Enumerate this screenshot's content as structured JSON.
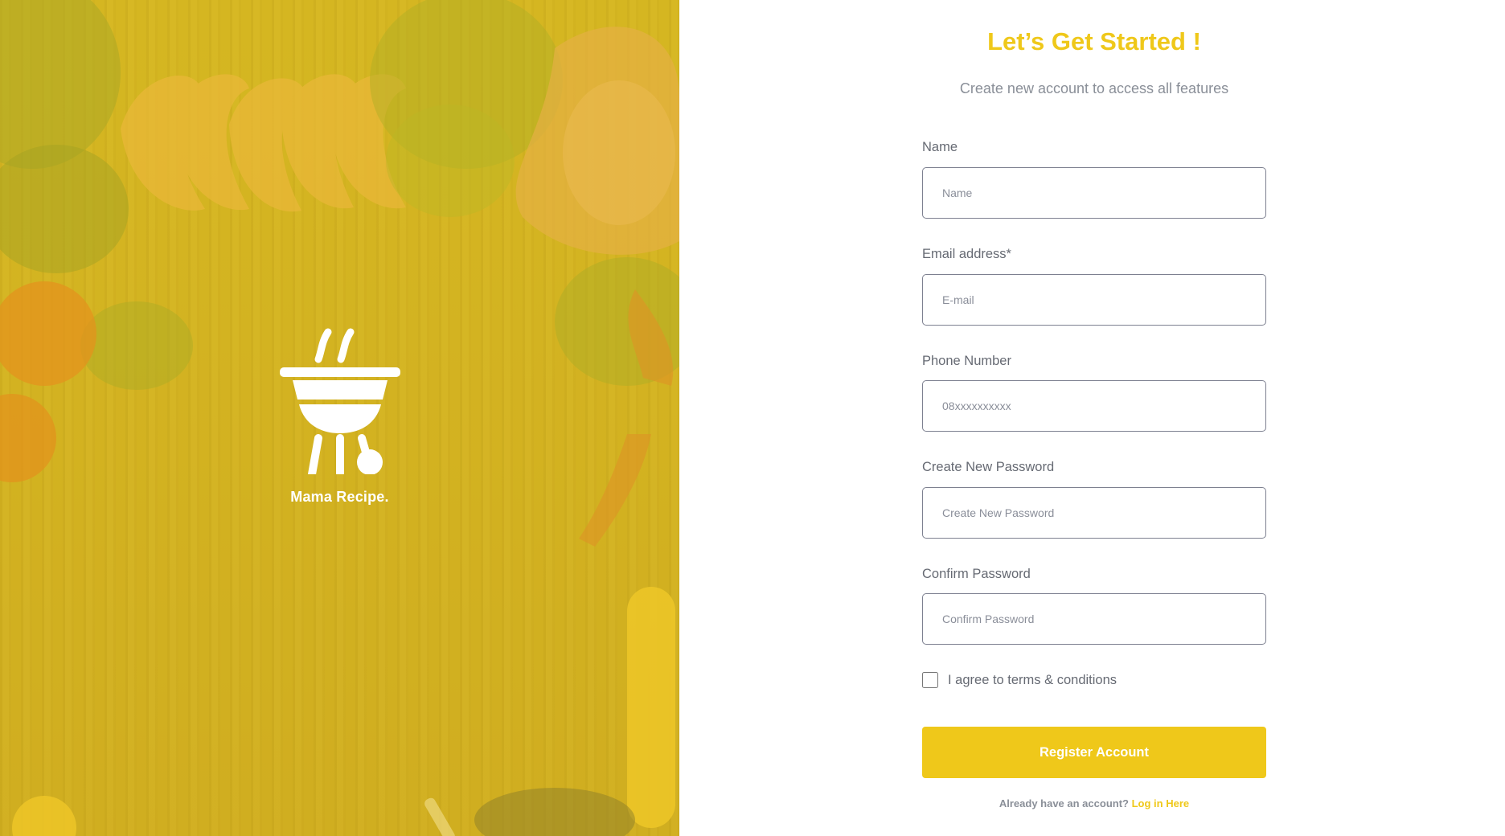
{
  "hero": {
    "brand_name": "Mama Recipe."
  },
  "form": {
    "title": "Let’s Get Started !",
    "subtitle": "Create new account to access all features",
    "fields": [
      {
        "label": "Name",
        "placeholder": "Name",
        "value": ""
      },
      {
        "label": "Email address*",
        "placeholder": "E-mail",
        "value": ""
      },
      {
        "label": "Phone Number",
        "placeholder": "08xxxxxxxxxx",
        "value": ""
      },
      {
        "label": "Create New Password",
        "placeholder": "Create New Password",
        "value": ""
      },
      {
        "label": "Confirm Password",
        "placeholder": "Confirm Password",
        "value": ""
      }
    ],
    "terms_label": "I agree to terms & conditions",
    "terms_checked": false,
    "register_label": "Register Account",
    "login_prompt": "Already have an account?",
    "login_link": "Log in Here"
  },
  "icons": {
    "brand_logo": "grill-icon"
  },
  "colors": {
    "accent": "#efc81a",
    "hero_tint": "#c9b024",
    "label_text": "#666a73",
    "muted_text": "#8a8f98",
    "input_border": "#7d8090"
  }
}
